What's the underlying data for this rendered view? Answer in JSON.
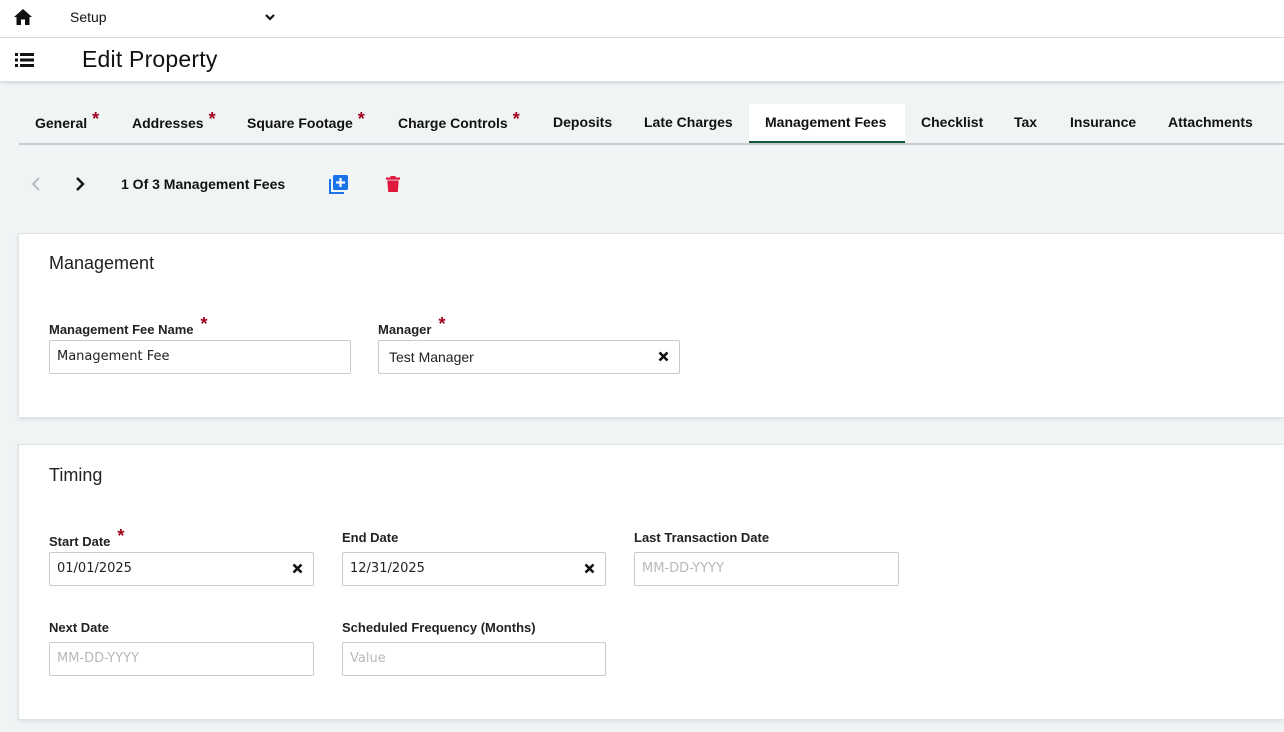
{
  "topbar": {
    "module_select": "Setup"
  },
  "header": {
    "title": "Edit Property"
  },
  "tabs": [
    {
      "label": "General",
      "required": "*"
    },
    {
      "label": "Addresses",
      "required": "*"
    },
    {
      "label": "Square Footage",
      "required": "*"
    },
    {
      "label": "Charge Controls",
      "required": "*"
    },
    {
      "label": "Deposits"
    },
    {
      "label": "Late Charges"
    },
    {
      "label": "Management Fees",
      "active": true
    },
    {
      "label": "Checklist"
    },
    {
      "label": "Tax"
    },
    {
      "label": "Insurance"
    },
    {
      "label": "Attachments"
    }
  ],
  "pager": {
    "text": "1 Of 3 Management Fees"
  },
  "management": {
    "title": "Management",
    "fee_name_label": "Management Fee Name",
    "fee_name_value": "Management Fee",
    "manager_label": "Manager",
    "manager_value": "Test Manager",
    "required": "*"
  },
  "timing": {
    "title": "Timing",
    "start_date_label": "Start Date",
    "start_date_value": "01/01/2025",
    "end_date_label": "End Date",
    "end_date_value": "12/31/2025",
    "last_txn_label": "Last Transaction Date",
    "last_txn_placeholder": "MM-DD-YYYY",
    "next_date_label": "Next Date",
    "next_date_placeholder": "MM-DD-YYYY",
    "frequency_label": "Scheduled Frequency (Months)",
    "frequency_placeholder": "Value",
    "required": "*"
  },
  "colors": {
    "accent_green": "#0e5a3a",
    "required_red": "#a0001c",
    "add_blue": "#1a73e8",
    "delete_red": "#e0183c"
  },
  "icons": {
    "home": "home-icon",
    "menu": "list-menu-icon",
    "prev": "chevron-left-icon",
    "next": "chevron-right-icon",
    "add": "add-copy-icon",
    "delete": "trash-icon",
    "clear": "close-icon"
  }
}
